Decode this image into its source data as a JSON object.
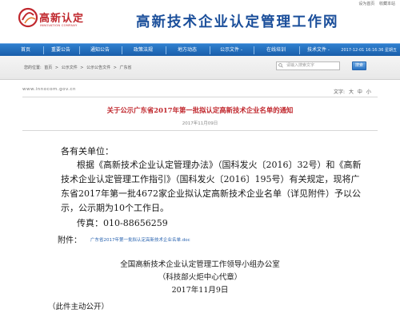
{
  "top_links": [
    "设为首页",
    "收藏本站"
  ],
  "logo": {
    "name": "高新认定",
    "subtitle": "INNOVATION COMPANY",
    "color": "#c0272d"
  },
  "site_title": "高新技术企业认定管理工作网",
  "nav": {
    "items": [
      "首页",
      "重要公告",
      "通知公告",
      "政策法规",
      "地方动态",
      "公示文件 -",
      "在线培训",
      "技术文件 -"
    ],
    "datetime": "2017-12-01 16:16:36 星期五",
    "color": "#1a5faa"
  },
  "breadcrumb": {
    "prefix": "您的位置:",
    "items": [
      "首页",
      "公示文件",
      "公示公告文件",
      "广东省"
    ],
    "separator": ">"
  },
  "search": {
    "placeholder": "请输入搜索文字",
    "button_label": "搜索"
  },
  "url_text": "www.innocom.gov.cn",
  "font_size": {
    "label": "文字:",
    "options": [
      "大",
      "中",
      "小"
    ]
  },
  "article": {
    "title": "关于公示广东省2017年第一批拟认定高新技术企业名单的通知",
    "date": "2017年11月09日",
    "salutation": "各有关单位：",
    "paragraph_lines": [
      "根据《高新技术企业认定管理办法》（国科发火〔2016〕32号）和《高新",
      "技术企业认定管理工作指引》（国科发火〔2016〕195号）有关规定，现将广",
      "东省2017年第一批4672家企业拟认定高新技术企业名单（详见附件）予以公",
      "示，公示期为10个工作日。"
    ],
    "phone": "传真：010-88656259",
    "attachment_label": "附件：",
    "attachment_name": "广东省2017年第一批拟认定高新技术企业名单.doc",
    "signature": [
      "全国高新技术企业认定管理工作领导小组办公室",
      "（科技部火炬中心代章）",
      "2017年11月9日"
    ],
    "note": "（此件主动公开）"
  }
}
